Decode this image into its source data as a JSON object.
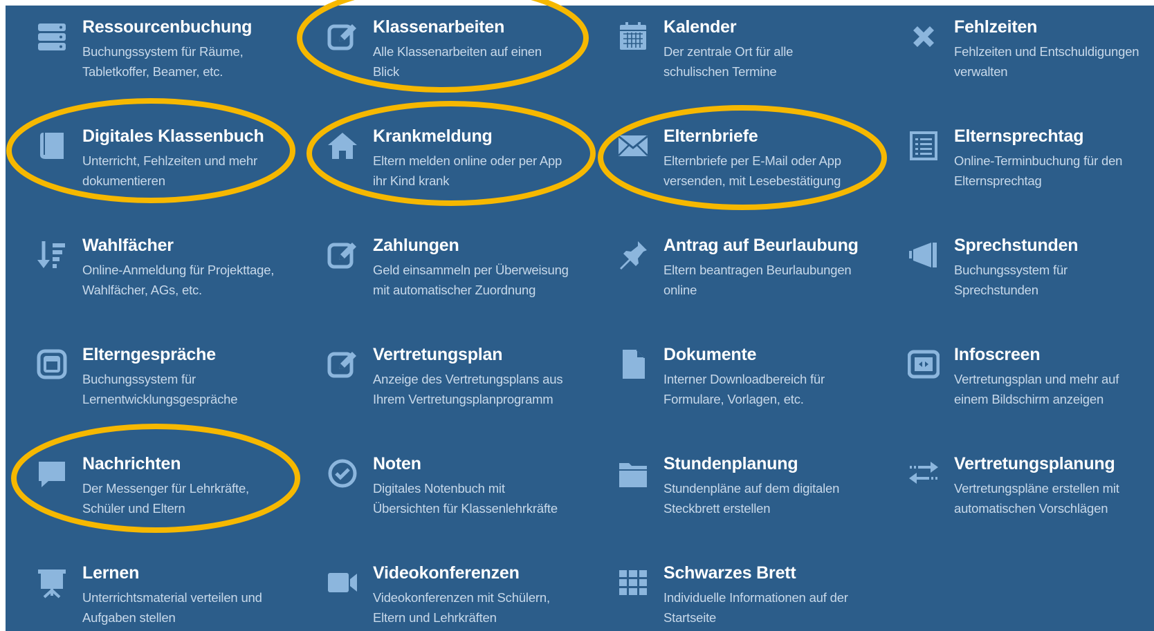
{
  "colors": {
    "background": "#2c5d8a",
    "icon": "#8cb6dd",
    "title": "#ffffff",
    "text": "#c8d9ea",
    "highlight": "#f6b800"
  },
  "modules": [
    {
      "title": "Ressourcenbuchung",
      "desc1": "Buchungssystem für Räume,",
      "desc2": "Tabletkoffer, Beamer, etc.",
      "icon": "server-icon"
    },
    {
      "title": "Klassenarbeiten",
      "desc1": "Alle Klassenarbeiten auf einen",
      "desc2": "Blick",
      "icon": "edit-icon"
    },
    {
      "title": "Kalender",
      "desc1": "Der zentrale Ort für alle",
      "desc2": "schulischen Termine",
      "icon": "calendar-icon"
    },
    {
      "title": "Fehlzeiten",
      "desc1": "Fehlzeiten und Entschuldigungen",
      "desc2": "verwalten",
      "icon": "x-icon"
    },
    {
      "title": "Digitales Klassenbuch",
      "desc1": "Unterricht, Fehlzeiten und mehr",
      "desc2": "dokumentieren",
      "icon": "book-icon"
    },
    {
      "title": "Krankmeldung",
      "desc1": "Eltern melden online oder per App",
      "desc2": "ihr Kind krank",
      "icon": "home-icon"
    },
    {
      "title": "Elternbriefe",
      "desc1": "Elternbriefe per E-Mail oder App",
      "desc2": "versenden, mit Lesebestätigung",
      "icon": "envelope-icon"
    },
    {
      "title": "Elternsprechtag",
      "desc1": "Online-Terminbuchung für den",
      "desc2": "Elternsprechtag",
      "icon": "list-icon"
    },
    {
      "title": "Wahlfächer",
      "desc1": "Online-Anmeldung für Projekttage,",
      "desc2": "Wahlfächer, AGs, etc.",
      "icon": "sort-icon"
    },
    {
      "title": "Zahlungen",
      "desc1": "Geld einsammeln per Überweisung",
      "desc2": "mit automatischer Zuordnung",
      "icon": "edit-icon"
    },
    {
      "title": "Antrag auf Beurlaubung",
      "desc1": "Eltern beantragen Beurlaubungen",
      "desc2": "online",
      "icon": "pin-icon"
    },
    {
      "title": "Sprechstunden",
      "desc1": "Buchungssystem für",
      "desc2": "Sprechstunden",
      "icon": "megaphone-icon"
    },
    {
      "title": "Elterngespräche",
      "desc1": "Buchungssystem für",
      "desc2": "Lernentwicklungsgespräche",
      "icon": "window-icon"
    },
    {
      "title": "Vertretungsplan",
      "desc1": "Anzeige des Vertretungsplans aus",
      "desc2": "Ihrem Vertretungsplanprogramm",
      "icon": "edit-icon"
    },
    {
      "title": "Dokumente",
      "desc1": "Interner Downloadbereich für",
      "desc2": "Formulare, Vorlagen, etc.",
      "icon": "file-icon"
    },
    {
      "title": "Infoscreen",
      "desc1": "Vertretungsplan und mehr auf",
      "desc2": "einem Bildschirm anzeigen",
      "icon": "screen-icon"
    },
    {
      "title": "Nachrichten",
      "desc1": "Der Messenger für Lehrkräfte,",
      "desc2": "Schüler und Eltern",
      "icon": "chat-icon"
    },
    {
      "title": "Noten",
      "desc1": "Digitales Notenbuch mit",
      "desc2": "Übersichten für Klassenlehrkräfte",
      "icon": "check-circle-icon"
    },
    {
      "title": "Stundenplanung",
      "desc1": "Stundenpläne auf dem digitalen",
      "desc2": "Steckbrett erstellen",
      "icon": "folder-icon"
    },
    {
      "title": "Vertretungsplanung",
      "desc1": "Vertretungspläne erstellen mit",
      "desc2": "automatischen Vorschlägen",
      "icon": "exchange-icon"
    },
    {
      "title": "Lernen",
      "desc1": "Unterrichtsmaterial verteilen und",
      "desc2": "Aufgaben stellen",
      "icon": "easel-icon"
    },
    {
      "title": "Videokonferenzen",
      "desc1": "Videokonferenzen mit Schülern,",
      "desc2": "Eltern und Lehrkräften",
      "icon": "video-icon"
    },
    {
      "title": "Schwarzes Brett",
      "desc1": "Individuelle Informationen auf der",
      "desc2": "Startseite",
      "icon": "grid-icon"
    }
  ],
  "highlighted_modules": [
    "Klassenarbeiten",
    "Digitales Klassenbuch",
    "Krankmeldung",
    "Elternbriefe",
    "Nachrichten"
  ]
}
